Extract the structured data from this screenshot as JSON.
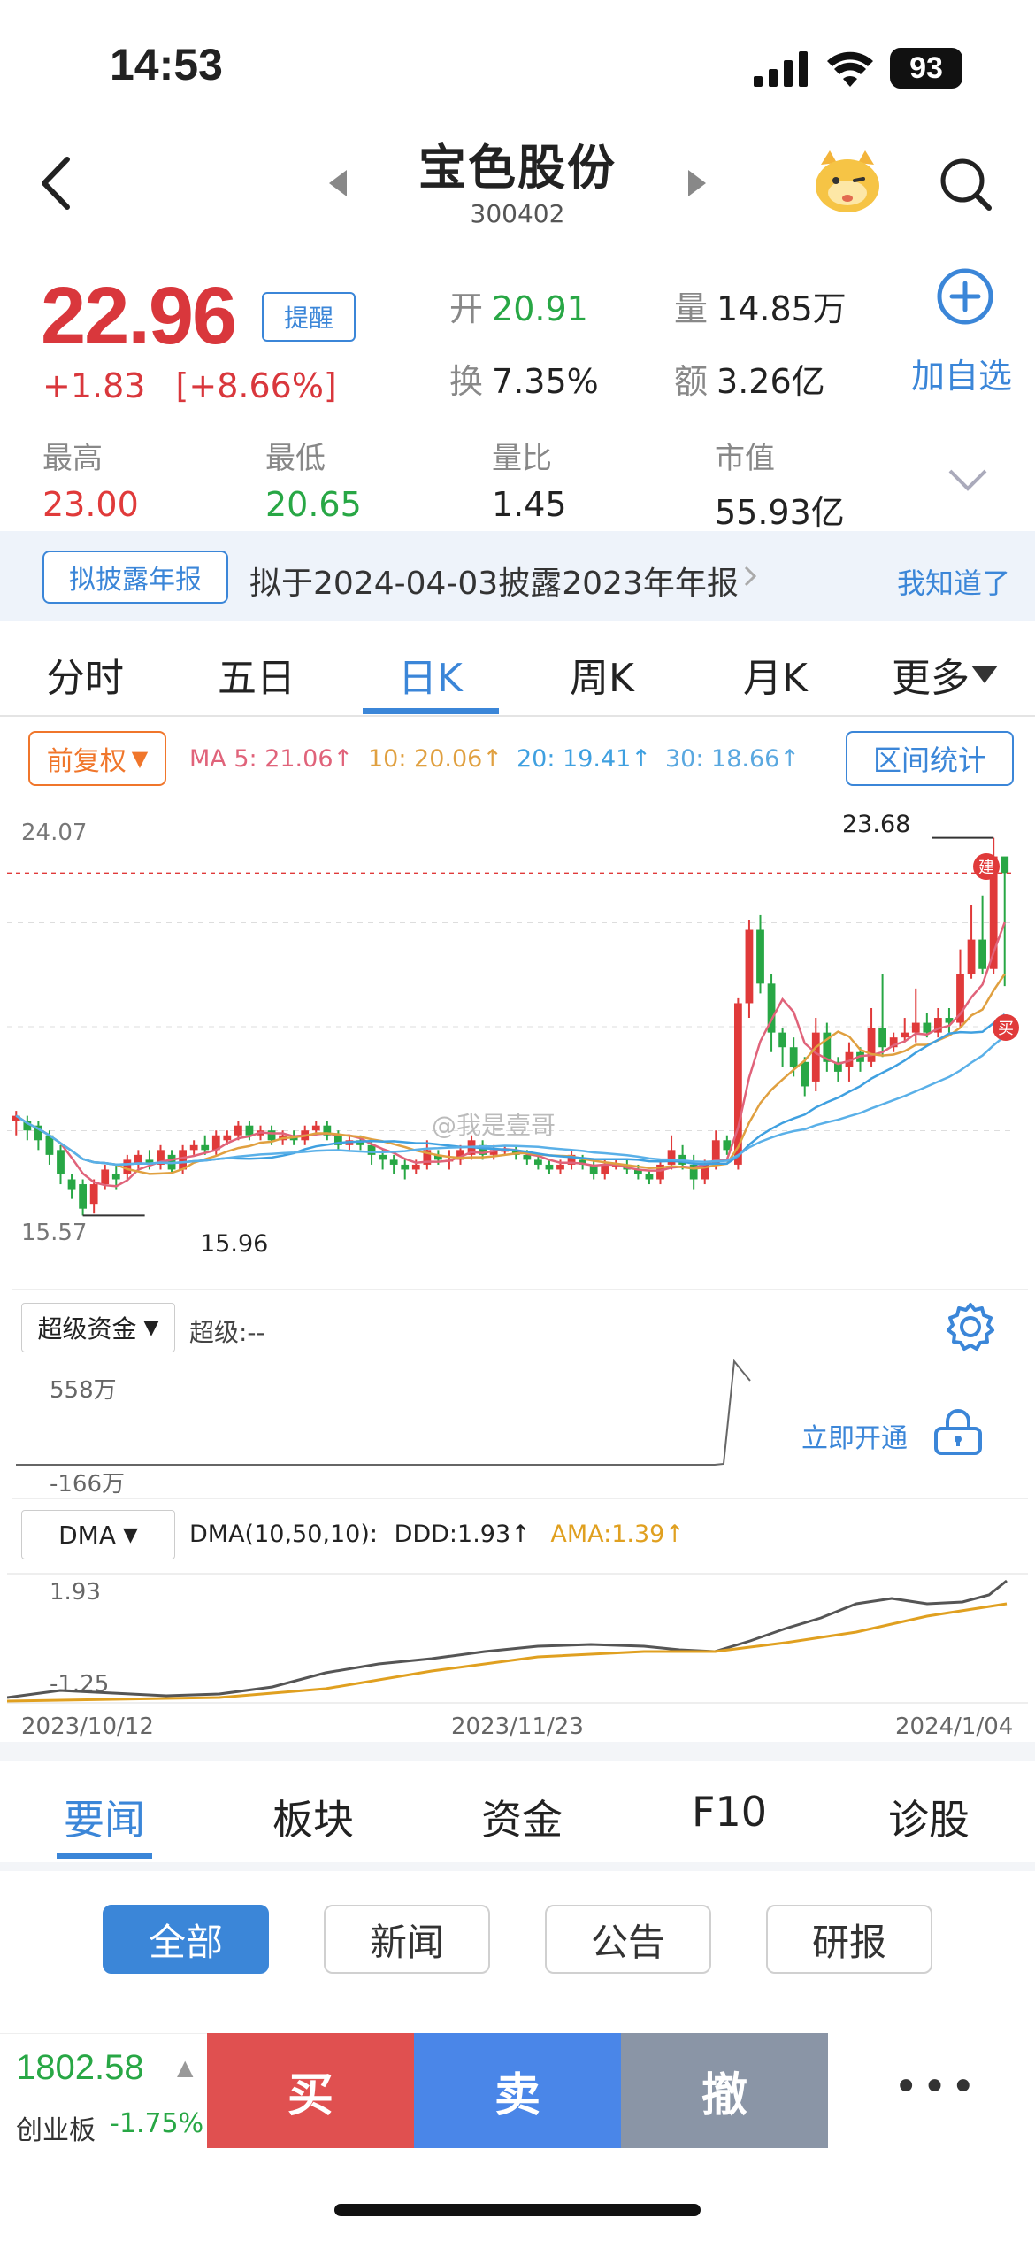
{
  "status_bar": {
    "time": "14:53",
    "battery": "93"
  },
  "header": {
    "name": "宝色股份",
    "code": "300402"
  },
  "quote": {
    "price": "22.96",
    "change": "+1.83",
    "change_pct": "[+8.66%]",
    "remind_label": "提醒",
    "open_label": "开",
    "open": "20.91",
    "volume_label": "量",
    "volume": "14.85万",
    "turnover_label": "换",
    "turnover": "7.35%",
    "amount_label": "额",
    "amount": "3.26亿",
    "add_watch_label": "加自选",
    "high_label": "最高",
    "high": "23.00",
    "low_label": "最低",
    "low": "20.65",
    "vol_ratio_label": "量比",
    "vol_ratio": "1.45",
    "mkt_cap_label": "市值",
    "mkt_cap": "55.93亿"
  },
  "notice": {
    "tag": "拟披露年报",
    "text": "拟于2024-04-03披露2023年年报",
    "dismiss": "我知道了"
  },
  "tabs": [
    "分时",
    "五日",
    "日K",
    "周K",
    "月K",
    "更多"
  ],
  "active_tab": 2,
  "chart_toolbar": {
    "adjust": "前复权",
    "ma5": "MA 5: 21.06↑",
    "ma10": "10: 20.06↑",
    "ma20": "20: 19.41↑",
    "ma30": "30: 18.66↑",
    "range_stats": "区间统计"
  },
  "colors": {
    "up": "#e03a3a",
    "down": "#28a745",
    "accent": "#3b86d8",
    "ma5": "#e0637a",
    "ma10": "#e0a040",
    "ma20": "#3fa0e0",
    "ma30": "#5ab0e8"
  },
  "kline": {
    "price_top": "24.07",
    "price_bottom": "15.57",
    "high_mark": "23.68",
    "low_mark": "15.96",
    "build_badge": "建",
    "buy_badge": "买",
    "watermark": "@我是壹哥"
  },
  "super_funds": {
    "selector": "超级资金",
    "label": "超级:--",
    "top": "558万",
    "bottom": "-166万",
    "unlock": "立即开通"
  },
  "dma": {
    "selector": "DMA",
    "label": "DMA(10,50,10):",
    "ddd": "DDD:1.93↑",
    "ama": "AMA:1.39↑",
    "top": "1.93",
    "bottom": "-1.25"
  },
  "dates": [
    "2023/10/12",
    "2023/11/23",
    "2024/1/04"
  ],
  "chart_data": {
    "type": "candlestick",
    "y_range": [
      15.57,
      24.07
    ],
    "candles": [
      [
        17.9,
        18.0,
        17.6,
        18.1
      ],
      [
        17.9,
        17.7,
        17.5,
        18.0
      ],
      [
        17.8,
        17.5,
        17.3,
        17.9
      ],
      [
        17.6,
        17.2,
        17.0,
        17.7
      ],
      [
        17.3,
        16.8,
        16.6,
        17.4
      ],
      [
        16.7,
        16.5,
        16.3,
        16.8
      ],
      [
        16.6,
        16.1,
        15.96,
        16.7
      ],
      [
        16.2,
        16.6,
        16.0,
        16.7
      ],
      [
        16.6,
        16.9,
        16.5,
        17.0
      ],
      [
        16.8,
        16.7,
        16.5,
        17.0
      ],
      [
        16.8,
        17.1,
        16.7,
        17.2
      ],
      [
        17.0,
        17.2,
        16.9,
        17.3
      ],
      [
        17.1,
        17.0,
        16.9,
        17.3
      ],
      [
        17.0,
        17.3,
        16.9,
        17.4
      ],
      [
        17.2,
        16.9,
        16.8,
        17.3
      ],
      [
        16.9,
        17.3,
        16.8,
        17.4
      ],
      [
        17.3,
        17.4,
        17.2,
        17.5
      ],
      [
        17.4,
        17.3,
        17.2,
        17.6
      ],
      [
        17.3,
        17.6,
        17.2,
        17.7
      ],
      [
        17.5,
        17.6,
        17.4,
        17.7
      ],
      [
        17.6,
        17.8,
        17.5,
        17.9
      ],
      [
        17.8,
        17.6,
        17.5,
        17.9
      ],
      [
        17.6,
        17.7,
        17.5,
        17.8
      ],
      [
        17.7,
        17.5,
        17.4,
        17.8
      ],
      [
        17.5,
        17.6,
        17.4,
        17.7
      ],
      [
        17.6,
        17.5,
        17.4,
        17.7
      ],
      [
        17.5,
        17.7,
        17.4,
        17.8
      ],
      [
        17.7,
        17.8,
        17.6,
        17.9
      ],
      [
        17.8,
        17.6,
        17.5,
        17.9
      ],
      [
        17.6,
        17.4,
        17.3,
        17.7
      ],
      [
        17.4,
        17.5,
        17.3,
        17.6
      ],
      [
        17.5,
        17.4,
        17.3,
        17.6
      ],
      [
        17.4,
        17.2,
        17.0,
        17.5
      ],
      [
        17.2,
        17.1,
        16.9,
        17.3
      ],
      [
        17.1,
        17.0,
        16.8,
        17.2
      ],
      [
        17.0,
        16.9,
        16.7,
        17.1
      ],
      [
        16.9,
        17.0,
        16.8,
        17.1
      ],
      [
        17.0,
        17.3,
        16.9,
        17.5
      ],
      [
        17.2,
        17.1,
        17.0,
        17.3
      ],
      [
        17.1,
        17.1,
        16.9,
        17.3
      ],
      [
        17.1,
        17.3,
        17.0,
        17.4
      ],
      [
        17.2,
        17.5,
        17.1,
        17.6
      ],
      [
        17.4,
        17.2,
        17.1,
        17.5
      ],
      [
        17.2,
        17.3,
        17.1,
        17.4
      ],
      [
        17.3,
        17.3,
        17.2,
        17.4
      ],
      [
        17.3,
        17.2,
        17.1,
        17.4
      ],
      [
        17.2,
        17.1,
        17.0,
        17.3
      ],
      [
        17.1,
        17.0,
        16.9,
        17.2
      ],
      [
        17.0,
        16.9,
        16.8,
        17.1
      ],
      [
        16.9,
        17.0,
        16.8,
        17.1
      ],
      [
        17.0,
        17.2,
        16.9,
        17.3
      ],
      [
        17.1,
        17.0,
        16.9,
        17.2
      ],
      [
        17.0,
        16.8,
        16.7,
        17.1
      ],
      [
        16.8,
        17.0,
        16.7,
        17.1
      ],
      [
        17.0,
        17.0,
        16.9,
        17.1
      ],
      [
        17.0,
        16.9,
        16.8,
        17.1
      ],
      [
        16.9,
        16.8,
        16.7,
        17.0
      ],
      [
        16.8,
        16.7,
        16.6,
        16.9
      ],
      [
        16.7,
        17.0,
        16.6,
        17.1
      ],
      [
        17.0,
        17.3,
        16.9,
        17.6
      ],
      [
        17.2,
        17.0,
        16.9,
        17.4
      ],
      [
        17.0,
        16.7,
        16.5,
        17.2
      ],
      [
        16.7,
        17.0,
        16.6,
        17.1
      ],
      [
        17.0,
        17.5,
        16.9,
        17.7
      ],
      [
        17.5,
        17.3,
        17.2,
        17.6
      ],
      [
        17.0,
        20.3,
        16.9,
        20.4
      ],
      [
        20.3,
        21.8,
        20.0,
        22.0
      ],
      [
        21.8,
        20.7,
        20.5,
        22.1
      ],
      [
        20.7,
        19.7,
        19.3,
        20.9
      ],
      [
        19.7,
        19.4,
        19.0,
        19.8
      ],
      [
        19.4,
        19.0,
        18.8,
        19.6
      ],
      [
        19.1,
        18.6,
        18.4,
        19.2
      ],
      [
        18.7,
        19.7,
        18.5,
        20.0
      ],
      [
        19.7,
        19.1,
        18.9,
        19.9
      ],
      [
        19.1,
        18.9,
        18.7,
        19.2
      ],
      [
        19.0,
        19.3,
        18.7,
        19.5
      ],
      [
        19.3,
        19.1,
        18.9,
        19.4
      ],
      [
        19.1,
        19.8,
        19.0,
        20.2
      ],
      [
        19.8,
        19.4,
        19.2,
        20.9
      ],
      [
        19.4,
        19.6,
        19.3,
        19.7
      ],
      [
        19.6,
        19.7,
        19.5,
        20.0
      ],
      [
        19.7,
        19.9,
        19.5,
        20.6
      ],
      [
        19.9,
        19.7,
        19.6,
        20.1
      ],
      [
        19.7,
        20.0,
        19.6,
        20.2
      ],
      [
        20.0,
        19.9,
        19.7,
        20.2
      ],
      [
        19.9,
        20.9,
        19.8,
        21.4
      ],
      [
        20.9,
        21.6,
        20.8,
        22.3
      ],
      [
        21.6,
        21.0,
        20.9,
        22.5
      ],
      [
        21.0,
        23.3,
        20.9,
        23.68
      ],
      [
        23.3,
        22.96,
        20.65,
        23.0
      ]
    ]
  }
}
